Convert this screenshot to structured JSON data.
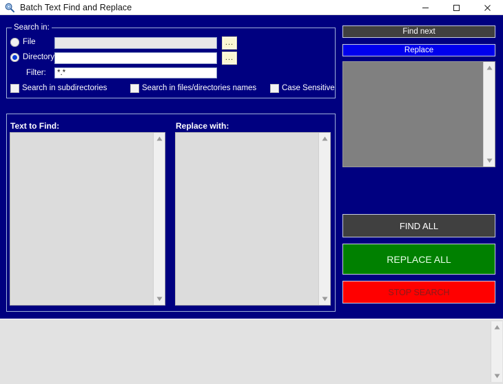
{
  "window": {
    "title": "Batch Text Find and Replace",
    "icon": "magnifier-icon",
    "minimize_label": "─",
    "maximize_label": "☐",
    "close_label": "✕"
  },
  "colors": {
    "background": "#000080",
    "titlebar": "#ffffff",
    "find_next_button": "#404040",
    "replace_button": "#0000ee",
    "find_all_button": "#404040",
    "replace_all_button": "#008000",
    "stop_search_button": "#ff0000",
    "results_box": "#808080",
    "textarea": "#dcdcdc",
    "browse_button": "#fbf7d2",
    "group_border": "#9fb0d8"
  },
  "search_in_group": {
    "legend": "Search in:",
    "file_radio": {
      "label": "File",
      "checked": false
    },
    "directory_radio": {
      "label": "Directory",
      "checked": true
    },
    "file_input": {
      "value": "",
      "placeholder": "",
      "disabled": true
    },
    "directory_input": {
      "value": "",
      "placeholder": "",
      "disabled": false
    },
    "filter_label": "Filter:",
    "filter_input": {
      "value": "*.*",
      "placeholder": ""
    },
    "file_browse_button": "...",
    "directory_browse_button": "...",
    "checkboxes": [
      {
        "label": "Search in subdirectories",
        "checked": false
      },
      {
        "label": "Search in files/directories names",
        "checked": false
      },
      {
        "label": "Case Sensitive",
        "checked": false
      }
    ]
  },
  "text_panel": {
    "find_label": "Text to Find:",
    "replace_label": "Replace with:",
    "find_textarea": {
      "value": "",
      "placeholder": ""
    },
    "replace_textarea": {
      "value": "",
      "placeholder": ""
    }
  },
  "actions": {
    "find_next": "Find next",
    "replace": "Replace",
    "find_all": "FIND ALL",
    "replace_all": "REPLACE ALL",
    "stop_search": "STOP SEARCH"
  },
  "results": {
    "value": "",
    "disabled": true
  },
  "status_log": {
    "value": ""
  }
}
